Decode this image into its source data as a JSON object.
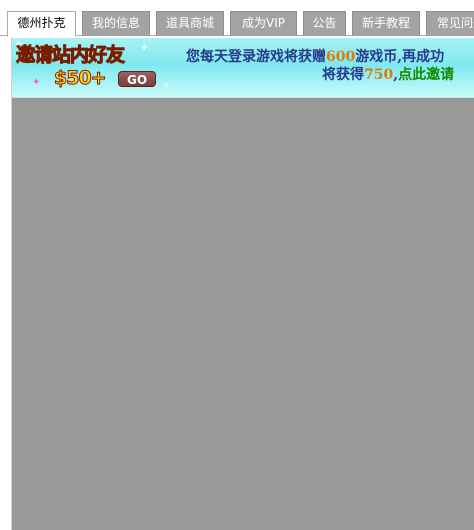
{
  "tabs": [
    {
      "label": "德州扑克",
      "active": true
    },
    {
      "label": "我的信息",
      "active": false
    },
    {
      "label": "道具商城",
      "active": false
    },
    {
      "label": "成为VIP",
      "active": false
    },
    {
      "label": "公告",
      "active": false
    },
    {
      "label": "新手教程",
      "active": false
    },
    {
      "label": "常见问题",
      "active": false
    }
  ],
  "banner": {
    "invite_title": "邀请站内好友",
    "invite_amount": "$50+",
    "go_label": "GO",
    "line1_prefix": "您每天登录游戏将获赠",
    "line1_number": "600",
    "line1_suffix": "游戏币,再成功",
    "line2_prefix": "将获得",
    "line2_number": "750",
    "line2_comma": ",",
    "line2_link": "点此邀请"
  },
  "colors": {
    "content_background": "#999999",
    "active_tab_background": "#ffffff",
    "inactive_tab_background": "#a3a3a3",
    "banner_background": "#8eeef2",
    "message_text": "#2a3a8a",
    "highlight_number": "#e07a00",
    "invite_link": "#118a00"
  }
}
